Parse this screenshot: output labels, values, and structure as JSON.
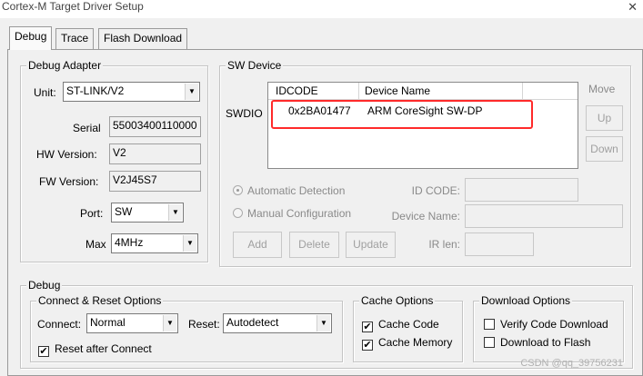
{
  "window": {
    "title": "Cortex-M Target Driver Setup",
    "close_glyph": "✕"
  },
  "tabs": [
    {
      "label": "Debug",
      "active": true
    },
    {
      "label": "Trace",
      "active": false
    },
    {
      "label": "Flash Download",
      "active": false
    }
  ],
  "debug_adapter": {
    "title": "Debug Adapter",
    "unit_label": "Unit:",
    "unit_value": "ST-LINK/V2",
    "serial_label": "Serial",
    "serial_value": "55003400110000",
    "hw_label": "HW Version:",
    "hw_value": "V2",
    "fw_label": "FW Version:",
    "fw_value": "V2J45S7",
    "port_label": "Port:",
    "port_value": "SW",
    "max_label": "Max",
    "max_value": "4MHz"
  },
  "sw_device": {
    "title": "SW Device",
    "swdio_label": "SWDIO",
    "columns": [
      "IDCODE",
      "Device Name"
    ],
    "rows": [
      {
        "idcode": "0x2BA01477",
        "device_name": "ARM CoreSight SW-DP"
      }
    ],
    "move_label": "Move",
    "up_label": "Up",
    "down_label": "Down",
    "auto_detect_label": "Automatic Detection",
    "manual_config_label": "Manual Configuration",
    "id_code_label": "ID CODE:",
    "device_name_label": "Device Name:",
    "ir_len_label": "IR len:",
    "add_label": "Add",
    "delete_label": "Delete",
    "update_label": "Update",
    "highlight_color": "#ff2a2a"
  },
  "debug": {
    "title": "Debug",
    "connect_reset": {
      "title": "Connect & Reset Options",
      "connect_label": "Connect:",
      "connect_value": "Normal",
      "reset_label": "Reset:",
      "reset_value": "Autodetect",
      "reset_after_connect_label": "Reset after Connect",
      "reset_after_connect_checked": true
    },
    "cache_options": {
      "title": "Cache Options",
      "cache_code_label": "Cache Code",
      "cache_memory_label": "Cache Memory"
    },
    "download_options": {
      "title": "Download Options",
      "verify_label": "Verify Code Download",
      "download_flash_label": "Download to Flash"
    }
  },
  "check_glyph": "✔",
  "watermark": "CSDN @qq_39756231"
}
